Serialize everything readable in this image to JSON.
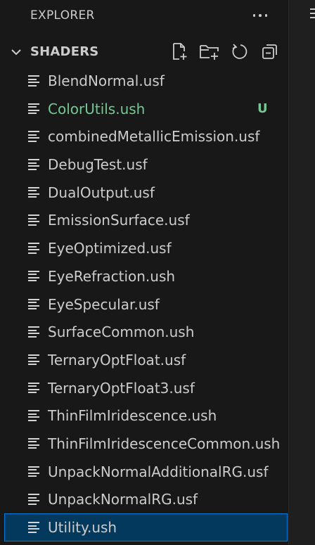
{
  "explorer": {
    "title": "EXPLORER",
    "more_icon": "ellipsis-icon"
  },
  "section": {
    "title": "SHADERS",
    "expanded": true,
    "actions": [
      "new-file-icon",
      "new-folder-icon",
      "refresh-icon",
      "collapse-all-icon"
    ]
  },
  "files": [
    {
      "name": "BlendNormal.usf",
      "status": ""
    },
    {
      "name": "ColorUtils.ush",
      "status": "U"
    },
    {
      "name": "combinedMetallicEmission.usf",
      "status": ""
    },
    {
      "name": "DebugTest.usf",
      "status": ""
    },
    {
      "name": "DualOutput.usf",
      "status": ""
    },
    {
      "name": "EmissionSurface.usf",
      "status": ""
    },
    {
      "name": "EyeOptimized.usf",
      "status": ""
    },
    {
      "name": "EyeRefraction.ush",
      "status": ""
    },
    {
      "name": "EyeSpecular.usf",
      "status": ""
    },
    {
      "name": "SurfaceCommon.ush",
      "status": ""
    },
    {
      "name": "TernaryOptFloat.usf",
      "status": ""
    },
    {
      "name": "TernaryOptFloat3.usf",
      "status": ""
    },
    {
      "name": "ThinFilmIridescence.ush",
      "status": ""
    },
    {
      "name": "ThinFilmIridescenceCommon.ush",
      "status": ""
    },
    {
      "name": "UnpackNormalAdditionalRG.usf",
      "status": ""
    },
    {
      "name": "UnpackNormalRG.usf",
      "status": ""
    },
    {
      "name": "Utility.ush",
      "status": "",
      "selected": true
    }
  ],
  "colors": {
    "background": "#181818",
    "text": "#cccccc",
    "untracked": "#73c991",
    "selection": "#04395e",
    "focus_border": "#0078d4"
  }
}
